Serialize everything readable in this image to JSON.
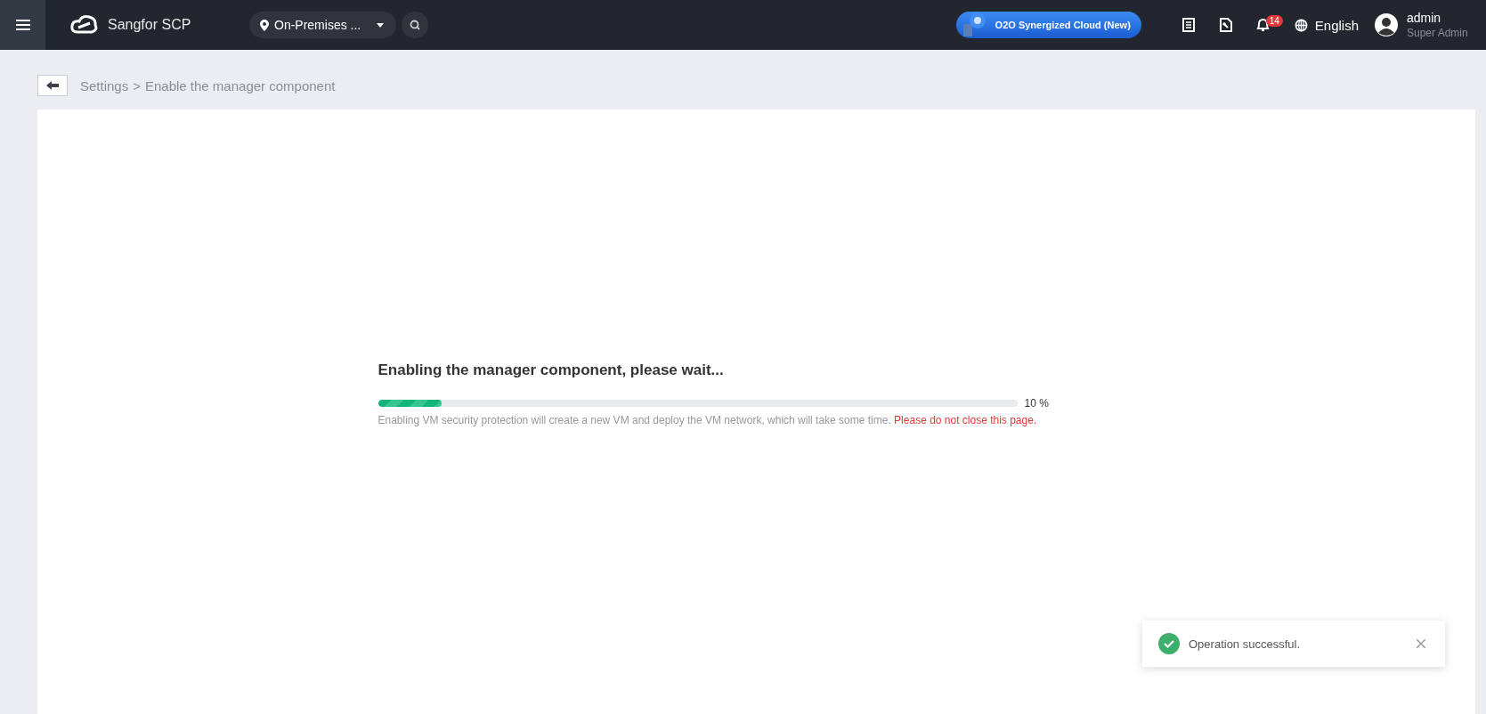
{
  "header": {
    "app_name": "Sangfor SCP",
    "location": "On-Premises ...",
    "promo": "O2O Synergized Cloud (New)",
    "notifications": "14",
    "language": "English",
    "user": {
      "name": "admin",
      "role": "Super Admin"
    }
  },
  "breadcrumb": {
    "parent": "Settings",
    "separator": ">",
    "current": "Enable the manager component"
  },
  "progress": {
    "title": "Enabling the manager component, please wait...",
    "level": 0.1,
    "reading": "10 %",
    "note": "Enabling VM security protection will create a new VM and deploy the VM network, which will take some time.",
    "warning": "Please do not close this page."
  },
  "toast": {
    "kind": "success",
    "message": "Operation successful."
  }
}
